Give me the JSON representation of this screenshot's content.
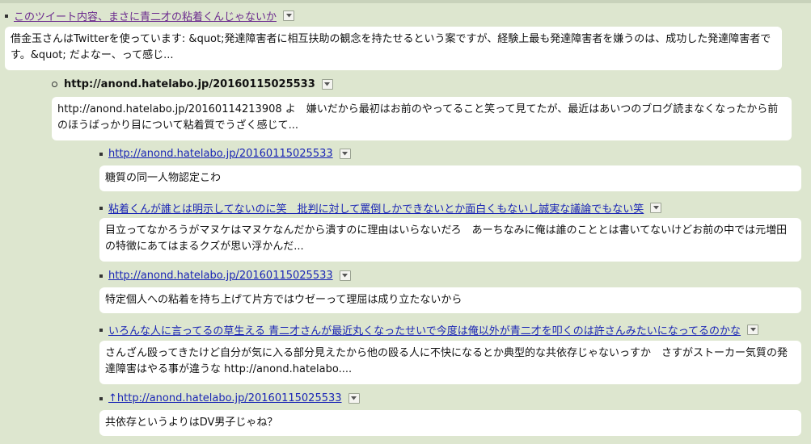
{
  "items": [
    {
      "title": "このツイート内容、まさに青二才の粘着くんじゃないか",
      "excerpt": "借金玉さんはTwitterを使っています: &quot;発達障害者に相互扶助の観念を持たせるという案ですが、経験上最も発達障害者を嫌うのは、成功した発達障害者です。&quot; だよなー、って感じ..."
    },
    {
      "title": "http://anond.hatelabo.jp/20160115025533",
      "excerpt": "http://anond.hatelabo.jp/20160114213908 よ　嫌いだから最初はお前のやってること笑って見てたが、最近はあいつのブログ読まなくなったから前のほうばっかり目について粘着質でうざく感じて..."
    },
    {
      "title": "http://anond.hatelabo.jp/20160115025533",
      "excerpt": "糖質の同一人物認定こわ"
    },
    {
      "title": "粘着くんが誰とは明示してないのに笑　批判に対して罵倒しかできないとか面白くもないし誠実な議論でもない笑",
      "excerpt": "目立ってなかろうがマヌケはマヌケなんだから潰すのに理由はいらないだろ　あーちなみに俺は誰のこととは書いてないけどお前の中では元増田の特徴にあてはまるクズが思い浮かんだ..."
    },
    {
      "title": "http://anond.hatelabo.jp/20160115025533",
      "excerpt": "特定個人への粘着を持ち上げて片方ではウゼーって理屈は成り立たないから"
    },
    {
      "title": "いろんな人に言ってるの草生える 青二才さんが最近丸くなったせいで今度は俺以外が青二才を叩くのは許さんみたいになってるのかな",
      "excerpt": "さんざん殴ってきたけど自分が気に入る部分見えたから他の殴る人に不快になるとか典型的な共依存じゃないっすか　さすがストーカー気質の発達障害はやる事が違うな http://anond.hatelabo...."
    },
    {
      "title": "↑http://anond.hatelabo.jp/20160115025533",
      "excerpt": "共依存というよりはDV男子じゃね？"
    }
  ]
}
